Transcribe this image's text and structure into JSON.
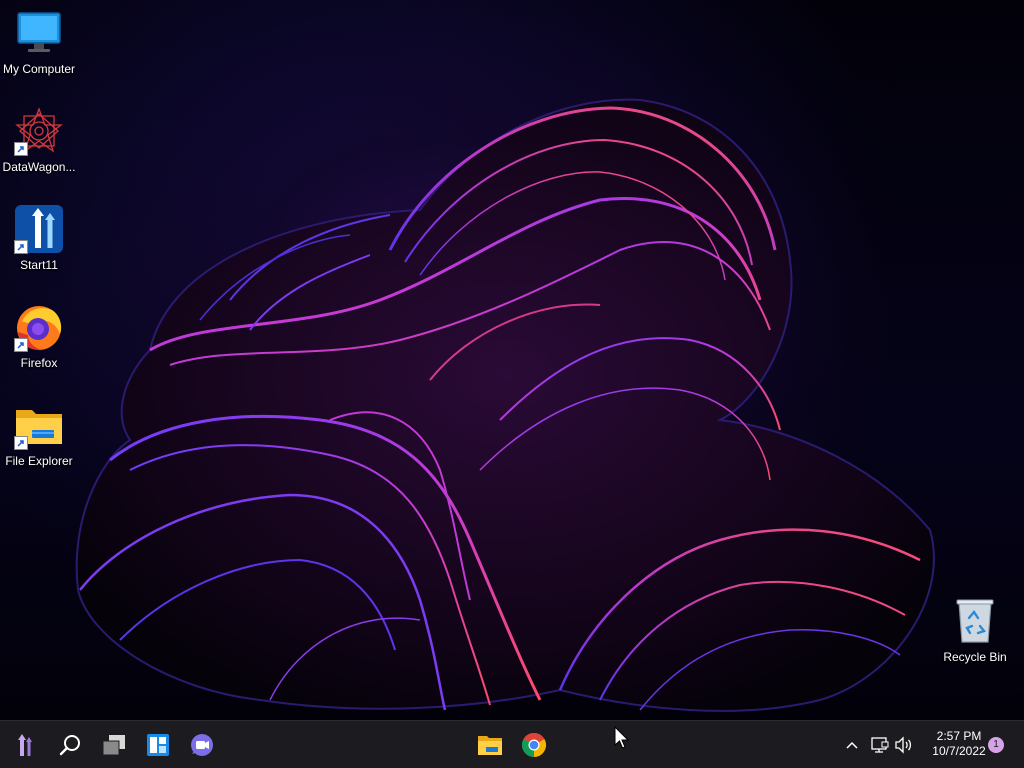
{
  "desktop": {
    "icons": [
      {
        "label": "My Computer"
      },
      {
        "label": "DataWagon..."
      },
      {
        "label": "Start11"
      },
      {
        "label": "Firefox"
      },
      {
        "label": "File Explorer"
      },
      {
        "label": "Recycle Bin"
      }
    ]
  },
  "taskbar": {
    "start_icon": "start11-logo-icon",
    "items": [
      "search-icon",
      "task-view-icon",
      "widgets-icon",
      "teams-chat-icon",
      "file-explorer-icon",
      "chrome-icon"
    ]
  },
  "tray": {
    "time": "2:57 PM",
    "date": "10/7/2022",
    "notification_count": "1"
  },
  "colors": {
    "accent_purple": "#9b3bd6",
    "accent_pink": "#e0407a",
    "taskbar_bg": "#1c1c20",
    "badge": "#d7a3e8"
  }
}
